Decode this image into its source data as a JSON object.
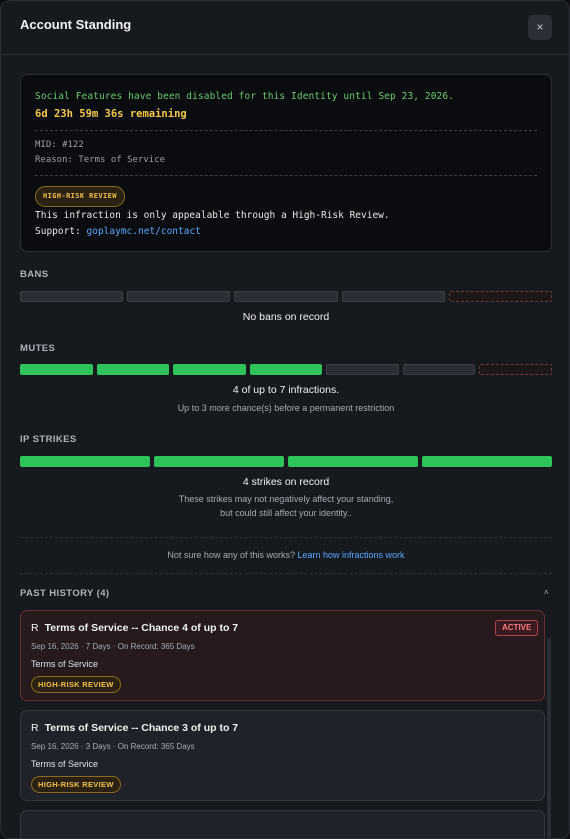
{
  "dialog": {
    "title": "Account Standing",
    "close_icon": "×"
  },
  "notice": {
    "line1": "Social Features have been disabled for this Identity until Sep 23, 2026.",
    "countdown": "6d 23h 59m 36s remaining",
    "mid": "MID: #122",
    "reason": "Reason: Terms of Service",
    "badge": "HIGH-RISK REVIEW",
    "appeal": "This infraction is only appealable through a High-Risk Review.",
    "support_label": "Support:",
    "support_link": "goplaymc.net/contact"
  },
  "bans": {
    "label": "BANS",
    "segments_total": 5,
    "filled": 0,
    "summary": "No bans on record"
  },
  "mutes": {
    "label": "MUTES",
    "segments_total": 7,
    "filled": 4,
    "summary": "4 of up to 7 infractions.",
    "detail": "Up to 3 more chance(s) before a permanent restriction"
  },
  "ip_strikes": {
    "label": "IP STRIKES",
    "segments_total": 4,
    "filled": 4,
    "summary": "4 strikes on record",
    "detail1": "These strikes may not negatively affect your standing,",
    "detail2": "but could still affect your identity.."
  },
  "help": {
    "text": "Not sure how any of this works?",
    "link": "Learn how infractions work"
  },
  "history": {
    "label": "PAST HISTORY (4)",
    "chevron": "˄",
    "items": [
      {
        "icon": "R",
        "title": "Terms of Service -- Chance 4 of up to 7",
        "status": "ACTIVE",
        "meta": "Sep 16, 2026 · 7 Days · On Record: 365 Days",
        "reason": "Terms of Service",
        "badge": "HIGH-RISK REVIEW"
      },
      {
        "icon": "R",
        "title": "Terms of Service -- Chance 3 of up to 7",
        "meta": "Sep 16, 2026 · 3 Days · On Record: 365 Days",
        "reason": "Terms of Service",
        "badge": "HIGH-RISK REVIEW"
      }
    ]
  },
  "colors": {
    "filled": "#2fc45a",
    "empty": "#2b2f35",
    "accent_link": "#5aa8ff",
    "warning": "#f0c14a",
    "active": "#ff7a85"
  }
}
